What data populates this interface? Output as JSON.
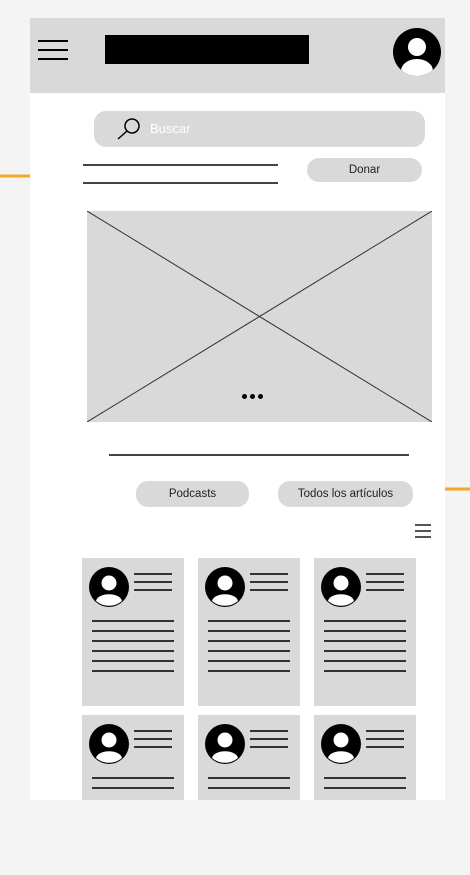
{
  "search": {
    "placeholder": "Buscar"
  },
  "actions": {
    "donate_label": "Donar"
  },
  "filters": {
    "podcasts_label": "Podcasts",
    "all_articles_label": "Todos los artículos"
  },
  "icons": {
    "menu": "hamburger-icon",
    "profile": "avatar-icon",
    "search": "search-icon",
    "carousel": "dots-icon",
    "list": "list-icon",
    "placeholder_image": "image-placeholder"
  },
  "colors": {
    "annotation_arrow": "#f5a623",
    "wireframe_gray": "#d9d9d9",
    "logo_block": "#000000"
  },
  "articles": [
    {
      "id": 1
    },
    {
      "id": 2
    },
    {
      "id": 3
    },
    {
      "id": 4
    },
    {
      "id": 5
    },
    {
      "id": 6
    }
  ]
}
